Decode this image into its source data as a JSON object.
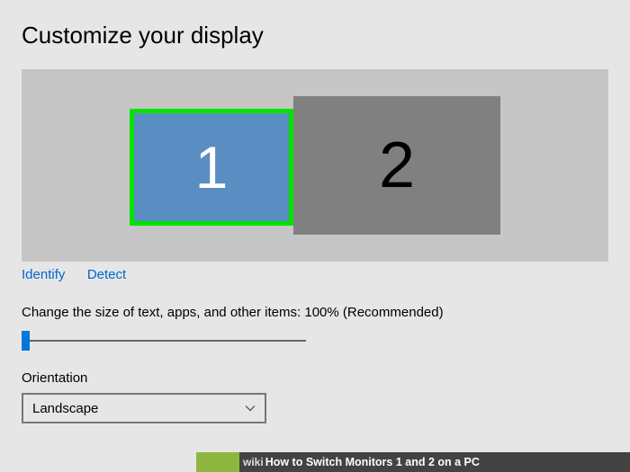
{
  "page_title": "Customize your display",
  "monitors": {
    "m1": {
      "label": "1",
      "selected": true
    },
    "m2": {
      "label": "2",
      "selected": false
    }
  },
  "links": {
    "identify": "Identify",
    "detect": "Detect"
  },
  "scale": {
    "label": "Change the size of text, apps, and other items: 100% (Recommended)",
    "value_percent": 0
  },
  "orientation": {
    "label": "Orientation",
    "value": "Landscape"
  },
  "footer": {
    "brand": "wikiHow",
    "article_title": "How to Switch Monitors 1 and 2 on a PC"
  }
}
